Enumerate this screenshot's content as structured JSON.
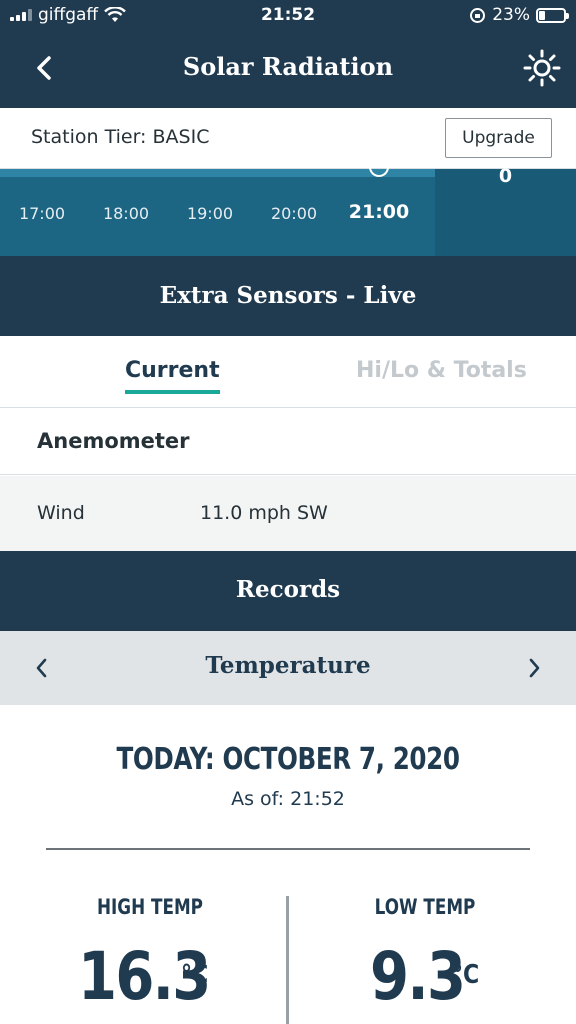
{
  "status_bar": {
    "carrier": "giffgaff",
    "time": "21:52",
    "battery": "23%",
    "battery_level": 0.23
  },
  "nav": {
    "title": "Solar Radiation",
    "back_icon": "chevron-left-icon",
    "action_icon": "sun-icon"
  },
  "tier": {
    "label": "Station Tier: BASIC",
    "upgrade_label": "Upgrade"
  },
  "timeline": {
    "hours": [
      "17:00",
      "18:00",
      "19:00",
      "20:00",
      "21:00"
    ],
    "active_hour": "21:00",
    "value": "0"
  },
  "extra_sensors": {
    "title": "Extra Sensors - Live",
    "tabs": [
      {
        "label": "Current",
        "active": true
      },
      {
        "label": "Hi/Lo & Totals",
        "active": false
      }
    ],
    "group_label": "Anemometer",
    "rows": [
      {
        "key": "Wind",
        "value": "11.0 mph SW"
      }
    ]
  },
  "records": {
    "title": "Records",
    "category": "Temperature",
    "date_heading": "TODAY: OCTOBER 7, 2020",
    "as_of": "As of: 21:52",
    "high": {
      "label": "HIGH TEMP",
      "value": "16.3",
      "unit": "°C"
    },
    "low": {
      "label": "LOW TEMP",
      "value": "9.3",
      "unit": "°C"
    }
  },
  "colors": {
    "navy": "#203a4f",
    "teal_accent": "#19a99a",
    "timeline_blue": "#1c6583"
  }
}
